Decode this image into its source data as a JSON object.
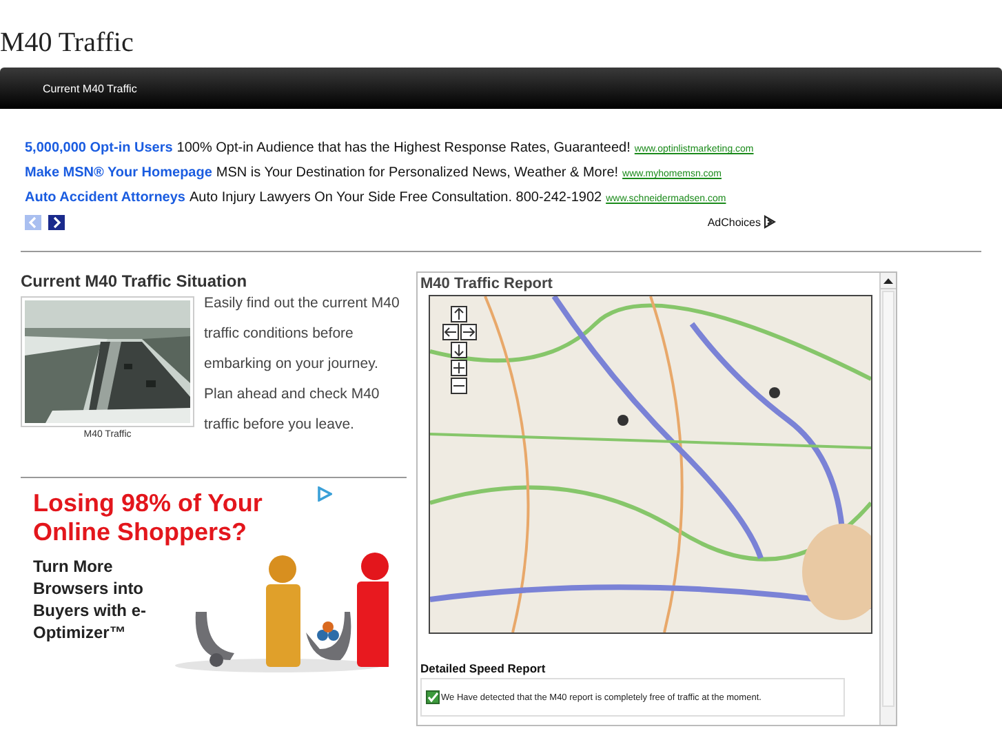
{
  "site_title": "M40 Traffic",
  "nav": {
    "tabs": [
      {
        "label": "Current M40 Traffic",
        "selected": true
      }
    ]
  },
  "text_ads": [
    {
      "headline": "5,000,000 Opt-in Users",
      "body": "100% Opt-in Audience that has the Highest Response Rates, Guaranteed!",
      "url": "www.optinlistmarketing.com"
    },
    {
      "headline": "Make MSN® Your Homepage",
      "body": "MSN is Your Destination for Personalized News, Weather & More!",
      "url": "www.myhomemsn.com"
    },
    {
      "headline": "Auto Accident Attorneys",
      "body": "Auto Injury Lawyers On Your Side Free Consultation. 800-242-1902",
      "url": "www.schneidermadsen.com"
    }
  ],
  "ad_nav": {
    "prev_disabled": true,
    "next_disabled": false
  },
  "ad_choices": "AdChoices",
  "situation": {
    "heading": "Current M40 Traffic Situation",
    "caption": "M40 Traffic",
    "text": "Easily find out the current M40 traffic conditions before embarking on your journey. Plan ahead and check M40 traffic before you leave."
  },
  "banner": {
    "headline": "Losing 98% of Your Online Shoppers?",
    "subline": "Turn More Browsers into Buyers with e-Optimizer™"
  },
  "report": {
    "title": "M40 Traffic Report",
    "speed_heading": "Detailed Speed Report",
    "status": {
      "checked": true,
      "text": "We Have detected that the M40 report is completely free of traffic at the moment."
    }
  }
}
